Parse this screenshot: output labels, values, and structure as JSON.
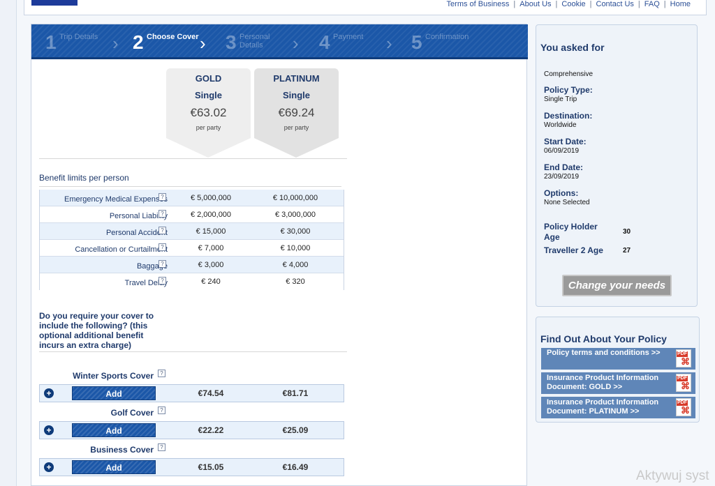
{
  "topnav": {
    "links": [
      "Terms of Business",
      "About Us",
      "Cookie",
      "Contact Us",
      "FAQ",
      "Home"
    ]
  },
  "steps": [
    {
      "num": "1",
      "label": "Trip Details"
    },
    {
      "num": "2",
      "label": "Choose Cover"
    },
    {
      "num": "3",
      "label": "Personal Details"
    },
    {
      "num": "4",
      "label": "Payment"
    },
    {
      "num": "5",
      "label": "Confirmation"
    }
  ],
  "plans": [
    {
      "name": "GOLD",
      "type": "Single",
      "price": "€63.02",
      "per": "per party"
    },
    {
      "name": "PLATINUM",
      "type": "Single",
      "price": "€69.24",
      "per": "per party"
    }
  ],
  "benefits": {
    "title": "Benefit limits per person",
    "help": "?",
    "rows": [
      {
        "name": "Emergency Medical Expenses",
        "gold": "€ 5,000,000",
        "platinum": "€ 10,000,000"
      },
      {
        "name": "Personal Liability",
        "gold": "€ 2,000,000",
        "platinum": "€ 3,000,000"
      },
      {
        "name": "Personal Accident",
        "gold": "€ 15,000",
        "platinum": "€ 30,000"
      },
      {
        "name": "Cancellation or Curtailment",
        "gold": "€ 7,000",
        "platinum": "€ 10,000"
      },
      {
        "name": "Baggage",
        "gold": "€ 3,000",
        "platinum": "€ 4,000"
      },
      {
        "name": "Travel Delay",
        "gold": "€ 240",
        "platinum": "€ 320"
      }
    ]
  },
  "options": {
    "question": "Do you require your cover to include the following? (this optional additional benefit incurs an extra charge)",
    "add_label": "Add",
    "plus": "+",
    "items": [
      {
        "name": "Winter Sports Cover",
        "gold": "€74.54",
        "platinum": "€81.71"
      },
      {
        "name": "Golf Cover",
        "gold": "€22.22",
        "platinum": "€25.09"
      },
      {
        "name": "Business Cover",
        "gold": "€15.05",
        "platinum": "€16.49"
      }
    ]
  },
  "summary": {
    "heading": "You asked for",
    "cover": "Comprehensive",
    "fields": [
      {
        "key": "Policy Type:",
        "value": "Single Trip"
      },
      {
        "key": "Destination:",
        "value": "Worldwide"
      },
      {
        "key": "Start Date:",
        "value": "06/09/2019"
      },
      {
        "key": "End Date:",
        "value": "23/09/2019"
      },
      {
        "key": "Options:",
        "value": "None Selected"
      }
    ],
    "holder_age_label": "Policy Holder Age",
    "holder_age": "30",
    "traveller2_label": "Traveller 2 Age",
    "traveller2_age": "27",
    "change_button": "Change your needs"
  },
  "documents": {
    "heading": "Find Out About Your Policy",
    "pdf_tag": "PDF",
    "items": [
      "Policy terms and conditions >>",
      "Insurance Product Information Document: GOLD >>",
      "Insurance Product Information Document: PLATINUM >>"
    ]
  },
  "watermark": "Aktywuj syst"
}
